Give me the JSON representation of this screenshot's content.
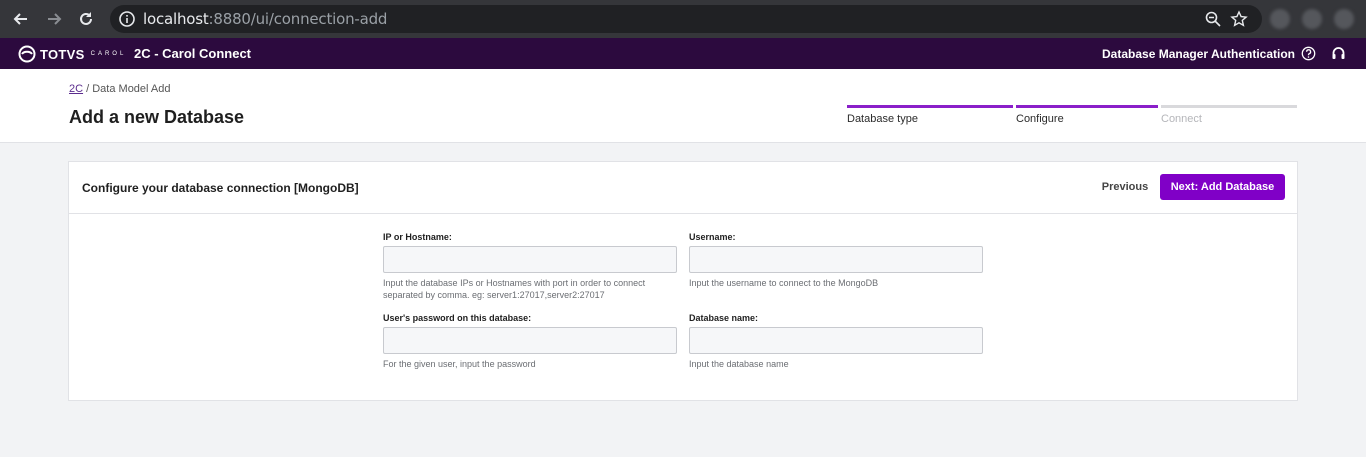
{
  "browser": {
    "url_host": "localhost",
    "url_rest": ":8880/ui/connection-add"
  },
  "app": {
    "logo_word": "TOTVS",
    "logo_sub": "CAROL",
    "title": "2C - Carol Connect",
    "nav": {
      "database_manager": "Database Manager",
      "authentication": "Authentication"
    }
  },
  "breadcrumb": {
    "root": "2C",
    "separator": " / ",
    "current": "Data Model Add"
  },
  "page": {
    "title": "Add a new Database"
  },
  "steps": [
    {
      "label": "Database type",
      "state": "done"
    },
    {
      "label": "Configure",
      "state": "active"
    },
    {
      "label": "Connect",
      "state": "pending"
    }
  ],
  "card": {
    "title": "Configure your database connection [MongoDB]",
    "previous_label": "Previous",
    "next_label": "Next: Add Database"
  },
  "form": {
    "host": {
      "label": "IP or Hostname:",
      "value": "",
      "help": "Input the database IPs or Hostnames with port in order to connect separated by comma. eg: server1:27017,server2:27017"
    },
    "username": {
      "label": "Username:",
      "value": "",
      "help": "Input the username to connect to the MongoDB"
    },
    "password": {
      "label": "User's password on this database:",
      "value": "",
      "help": "For the given user, input the password"
    },
    "dbname": {
      "label": "Database name:",
      "value": "",
      "help": "Input the database name"
    }
  },
  "colors": {
    "brand_dark": "#2c0a3e",
    "accent": "#8000c7",
    "step_done": "#8a1fc9",
    "step_pending": "#d9d9dc"
  }
}
